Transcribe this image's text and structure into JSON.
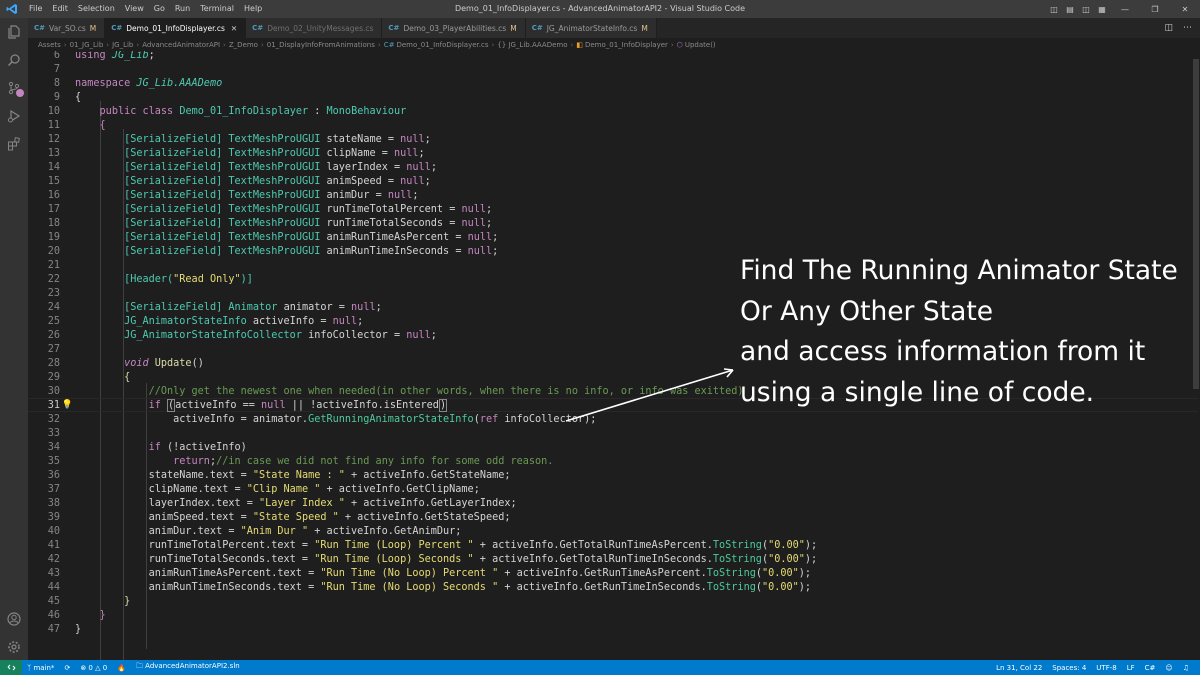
{
  "window": {
    "title": "Demo_01_InfoDisplayer.cs - AdvancedAnimatorAPI2 - Visual Studio Code",
    "menu": [
      "File",
      "Edit",
      "Selection",
      "View",
      "Go",
      "Run",
      "Terminal",
      "Help"
    ]
  },
  "tabs": [
    {
      "label": "Var_SO.cs",
      "mod": "M",
      "active": false
    },
    {
      "label": "Demo_01_InfoDisplayer.cs",
      "mod": "",
      "active": true
    },
    {
      "label": "Demo_02_UnityMessages.cs",
      "mod": "",
      "active": false
    },
    {
      "label": "Demo_03_PlayerAbilities.cs",
      "mod": "M",
      "active": false
    },
    {
      "label": "JG_AnimatorStateInfo.cs",
      "mod": "M",
      "active": false
    }
  ],
  "breadcrumb": [
    "Assets",
    "01_JG_Lib",
    "JG_Lib",
    "AdvancedAnimatorAPI",
    "Z_Demo",
    "01_DisplayInfoFromAnimations",
    "Demo_01_InfoDisplayer.cs",
    "{} JG_Lib.AAADemo",
    "Demo_01_InfoDisplayer",
    "Update()"
  ],
  "code": {
    "line_numbers": [
      "6",
      "7",
      "8",
      "9",
      "10",
      "11",
      "12",
      "13",
      "14",
      "15",
      "16",
      "17",
      "18",
      "19",
      "20",
      "21",
      "22",
      "23",
      "24",
      "25",
      "26",
      "27",
      "28",
      "29",
      "30",
      "31",
      "32",
      "33",
      "34",
      "35",
      "36",
      "37",
      "38",
      "39",
      "40",
      "41",
      "42",
      "43",
      "44",
      "45",
      "46",
      "47"
    ],
    "current_line": "31",
    "line_6": "using JG_Lib;",
    "ns_name": "JG_Lib.AAADemo",
    "class_name": "Demo_01_InfoDisplayer",
    "base_class": "MonoBehaviour",
    "fields": [
      "stateName",
      "clipName",
      "layerIndex",
      "animSpeed",
      "animDur",
      "runTimeTotalPercent",
      "runTimeTotalSeconds",
      "animRunTimeAsPercent",
      "animRunTimeInSeconds"
    ],
    "serialize_attr": "[SerializeField]",
    "tmp_type": "TextMeshProUGUI",
    "header_attr": "[Header(\"Read Only\")]",
    "line_24": "[SerializeField] Animator animator = null;",
    "line_25": "JG_AnimatorStateInfo activeInfo = null;",
    "line_26": "JG_AnimatorStateInfoCollector infoCollector = null;",
    "line_28": "void Update()",
    "line_30": "//Only get the newest one when needed(in other words, when there is no info, or info was exitted)",
    "line_31": "if (activeInfo == null || !activeInfo.isEntered)",
    "line_32": "activeInfo = animator.GetRunningAnimatorStateInfo(ref infoCollector);",
    "line_34": "if (!activeInfo)",
    "line_35": "return;//in case we did not find any info for some odd reason.",
    "line_36": "stateName.text = \"State Name : \" + activeInfo.GetStateName;",
    "line_37": "clipName.text = \"Clip Name \" + activeInfo.GetClipName;",
    "line_38": "layerIndex.text = \"Layer Index \" + activeInfo.GetLayerIndex;",
    "line_39": "animSpeed.text = \"State Speed \" + activeInfo.GetStateSpeed;",
    "line_40": "animDur.text = \"Anim Dur \" + activeInfo.GetAnimDur;",
    "line_41": "runTimeTotalPercent.text = \"Run Time (Loop) Percent \" + activeInfo.GetTotalRunTimeAsPercent.ToString(\"0.00\");",
    "line_42": "runTimeTotalSeconds.text = \"Run Time (Loop) Seconds \" + activeInfo.GetTotalRunTimeInSeconds.ToString(\"0.00\");",
    "line_43": "animRunTimeAsPercent.text = \"Run Time (No Loop) Percent \" + activeInfo.GetRunTimeAsPercent.ToString(\"0.00\");",
    "line_44": "animRunTimeInSeconds.text = \"Run Time (No Loop) Seconds \" + activeInfo.GetRunTimeInSeconds.ToString(\"0.00\");"
  },
  "annotation": {
    "line1": "Find The Running Animator State",
    "line2": "Or Any Other State",
    "line3": "and access information from it",
    "line4": "using a single line of code."
  },
  "statusbar": {
    "branch": "main*",
    "errors": "0",
    "warnings": "0",
    "solution": "AdvancedAnimatorAPI2.sln",
    "position": "Ln 31, Col 22",
    "spaces": "Spaces: 4",
    "encoding": "UTF-8",
    "eol": "LF",
    "language": "C#"
  },
  "colors": {
    "accent": "#007acc",
    "keyword": "#c586c0",
    "type": "#4ec9b0",
    "string": "#ce9178",
    "method": "#dcdcaa",
    "comment": "#6a9955"
  }
}
